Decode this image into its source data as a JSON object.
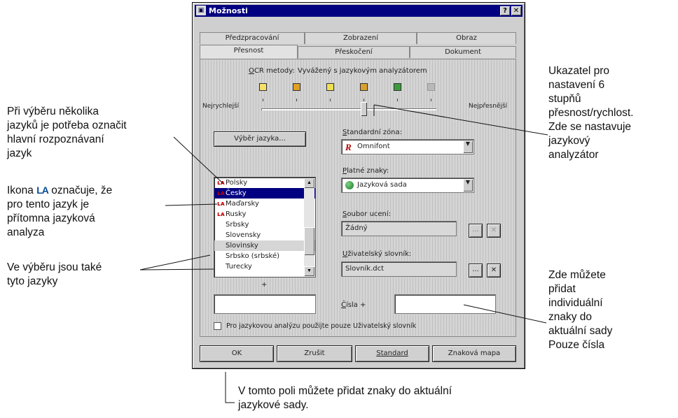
{
  "window": {
    "title": "Možnosti",
    "help_btn": "?",
    "close_btn": "✕",
    "app_icon": "app-icon"
  },
  "tabs_row1": [
    "Předzpracování",
    "Zobrazení",
    "Obraz"
  ],
  "tabs_row2": [
    "Přesnost",
    "Přeskočení",
    "Dokument"
  ],
  "ocr": {
    "label_u": "O",
    "label_rest": "CR metody:",
    "value": "Vyvážený s jazykovým analyzátorem",
    "left_label": "Nejrychlejší",
    "right_label": "Nejpřesnější",
    "levels": 6,
    "selected_level": 4,
    "level_colors": [
      "#f5e06a",
      "#e0a020",
      "#f0e050",
      "#d9a030",
      "#3c9c3c",
      "#b8b8b8"
    ]
  },
  "select_lang_button": "Výběr jazyka...",
  "languages": {
    "items": [
      {
        "name": "Polsky",
        "la": true
      },
      {
        "name": "Česky",
        "la": true,
        "selected": true
      },
      {
        "name": "Maďarsky",
        "la": true
      },
      {
        "name": "Rusky",
        "la": true
      },
      {
        "name": "Srbsky",
        "la": false
      },
      {
        "name": "Slovensky",
        "la": false
      },
      {
        "name": "Slovinsky",
        "la": false,
        "grey": true
      },
      {
        "name": "Srbsko (srbské)",
        "la": false
      },
      {
        "name": "Turecky",
        "la": false
      }
    ],
    "up_icon": "▲",
    "down_icon": "▼"
  },
  "plus_label": "+",
  "standard_zone": {
    "label_u": "S",
    "label_rest": "tandardní zóna:",
    "icon": "R",
    "value": "Omnifont"
  },
  "valid_chars": {
    "label_u": "P",
    "label_rest": "latné znaky:",
    "value": "Jazyková sada"
  },
  "training_file": {
    "label_u": "S",
    "label_rest": "oubor ucení:",
    "value": "Žádný",
    "browse": "...",
    "clear": "✕"
  },
  "user_dict": {
    "label_u": "U",
    "label_rest": "živatelský slovník:",
    "value": "Slovník.dct",
    "browse": "...",
    "clear": "✕"
  },
  "numbers": {
    "label_u": "Č",
    "label_rest": "ísla +"
  },
  "checkbox_label": "Pro jazykovou analýzu použijte pouze Uživatelský slovník",
  "buttons": {
    "ok": "OK",
    "cancel": "Zrušit",
    "standard": "Standard",
    "charmap": "Znaková mapa"
  },
  "annotations": {
    "left1": [
      "Při výběru několika",
      "jazyků je potřeba označit",
      "hlavní rozpoznávaní",
      "jazyk"
    ],
    "left2_before": "Ikona",
    "left2_icon": "LA",
    "left2_after": "označuje, že",
    "left2_rest": [
      "pro tento jazyk je",
      "přítomna jazyková",
      "analyza"
    ],
    "left3": [
      "Ve výběru jsou také",
      "tyto jazyky"
    ],
    "right1": [
      "Ukazatel pro",
      "nastavení 6",
      "stupňů",
      "přesnost/rychlost.",
      "Zde se nastavuje",
      "jazykový",
      "analyzátor"
    ],
    "right2": [
      "Zde můžete",
      "přidat",
      "individuální",
      "znaky do",
      "aktuální sady",
      "Pouze čísla"
    ],
    "bottom": [
      "V tomto poli můžete přidat znaky do aktuální",
      "jazykové sady."
    ]
  }
}
